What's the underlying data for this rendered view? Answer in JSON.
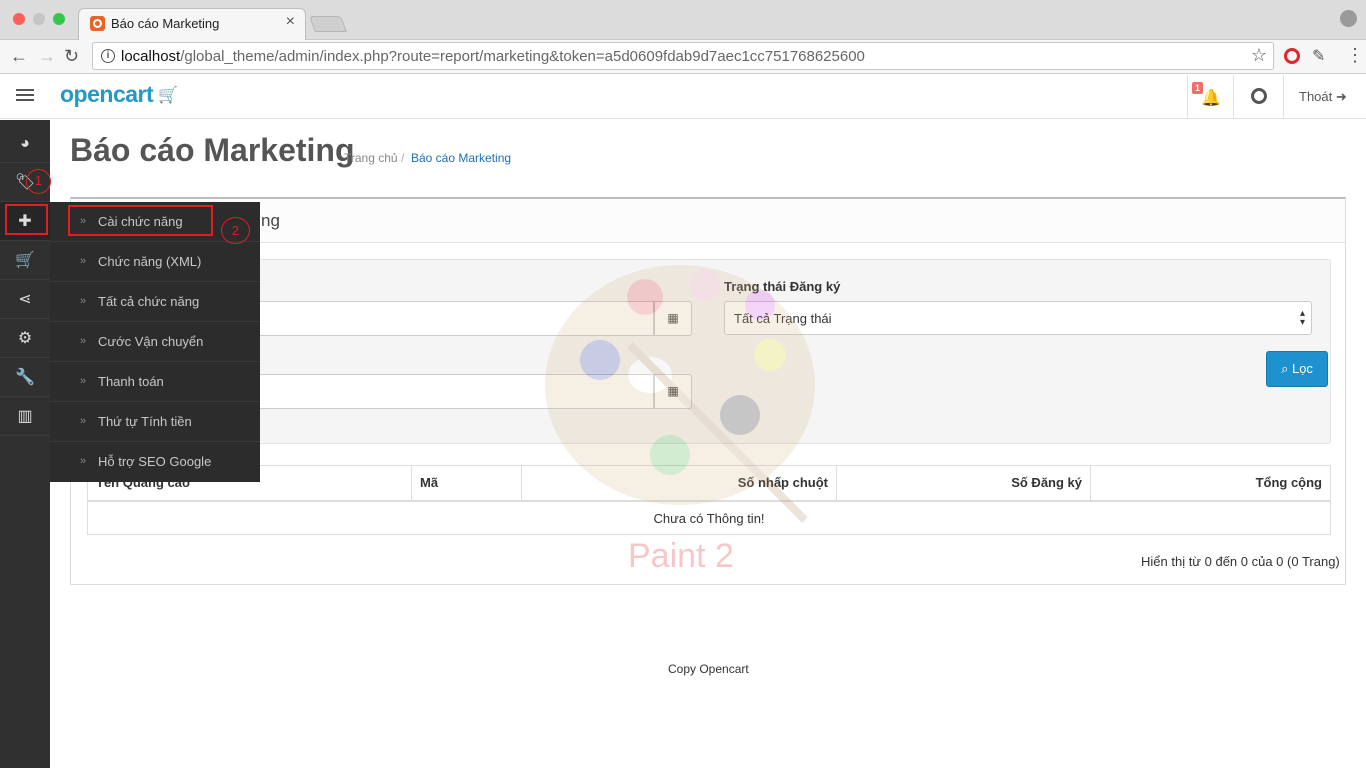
{
  "browser": {
    "tab_title": "Báo cáo Marketing",
    "url_host": "localhost",
    "url_path": "/global_theme/admin/index.php?route=report/marketing&token=a5d0609fdab9d7aec1cc751768625600"
  },
  "header": {
    "logo": "opencart",
    "notification_count": "1",
    "logout_label": "Thoát"
  },
  "sidebar": {
    "items": [
      "dashboard-icon",
      "tags-icon",
      "puzzle-icon",
      "cart-icon",
      "share-icon",
      "cog-icon",
      "wrench-icon",
      "bar-chart-icon"
    ]
  },
  "flyout": {
    "items": [
      {
        "label": "Cài chức năng"
      },
      {
        "label": "Chức năng (XML)"
      },
      {
        "label": "Tất cả chức năng"
      },
      {
        "label": "Cước Vận chuyển"
      },
      {
        "label": "Thanh toán"
      },
      {
        "label": "Thứ tự Tính tiền"
      },
      {
        "label": "Hỗ trợ SEO Google"
      }
    ]
  },
  "annotations": {
    "one": "1",
    "two": "2"
  },
  "page": {
    "title": "Báo cáo Marketing",
    "breadcrumb_home": "Trang chủ",
    "breadcrumb_sep": "/",
    "breadcrumb_current": "Báo cáo Marketing",
    "panel_heading_tail": "ng"
  },
  "filter": {
    "status_label": "Trạng thái Đăng ký",
    "status_value": "Tất cả Trạng thái",
    "filter_button": "Lọc"
  },
  "table": {
    "columns": [
      "Tên Quảng cáo",
      "Mã",
      "Số nhấp chuột",
      "Số Đăng ký",
      "Tổng cộng"
    ],
    "empty_text": "Chưa có Thông tin!",
    "pagination": "Hiển thị từ 0 đến 0 của 0 (0 Trang)"
  },
  "watermark": "Paint 2",
  "footer": "Copy Opencart",
  "colors": {
    "brand": "#229ac8",
    "sidebar": "#303030",
    "primary_button": "#1e91cf",
    "annotation": "#e02020"
  }
}
